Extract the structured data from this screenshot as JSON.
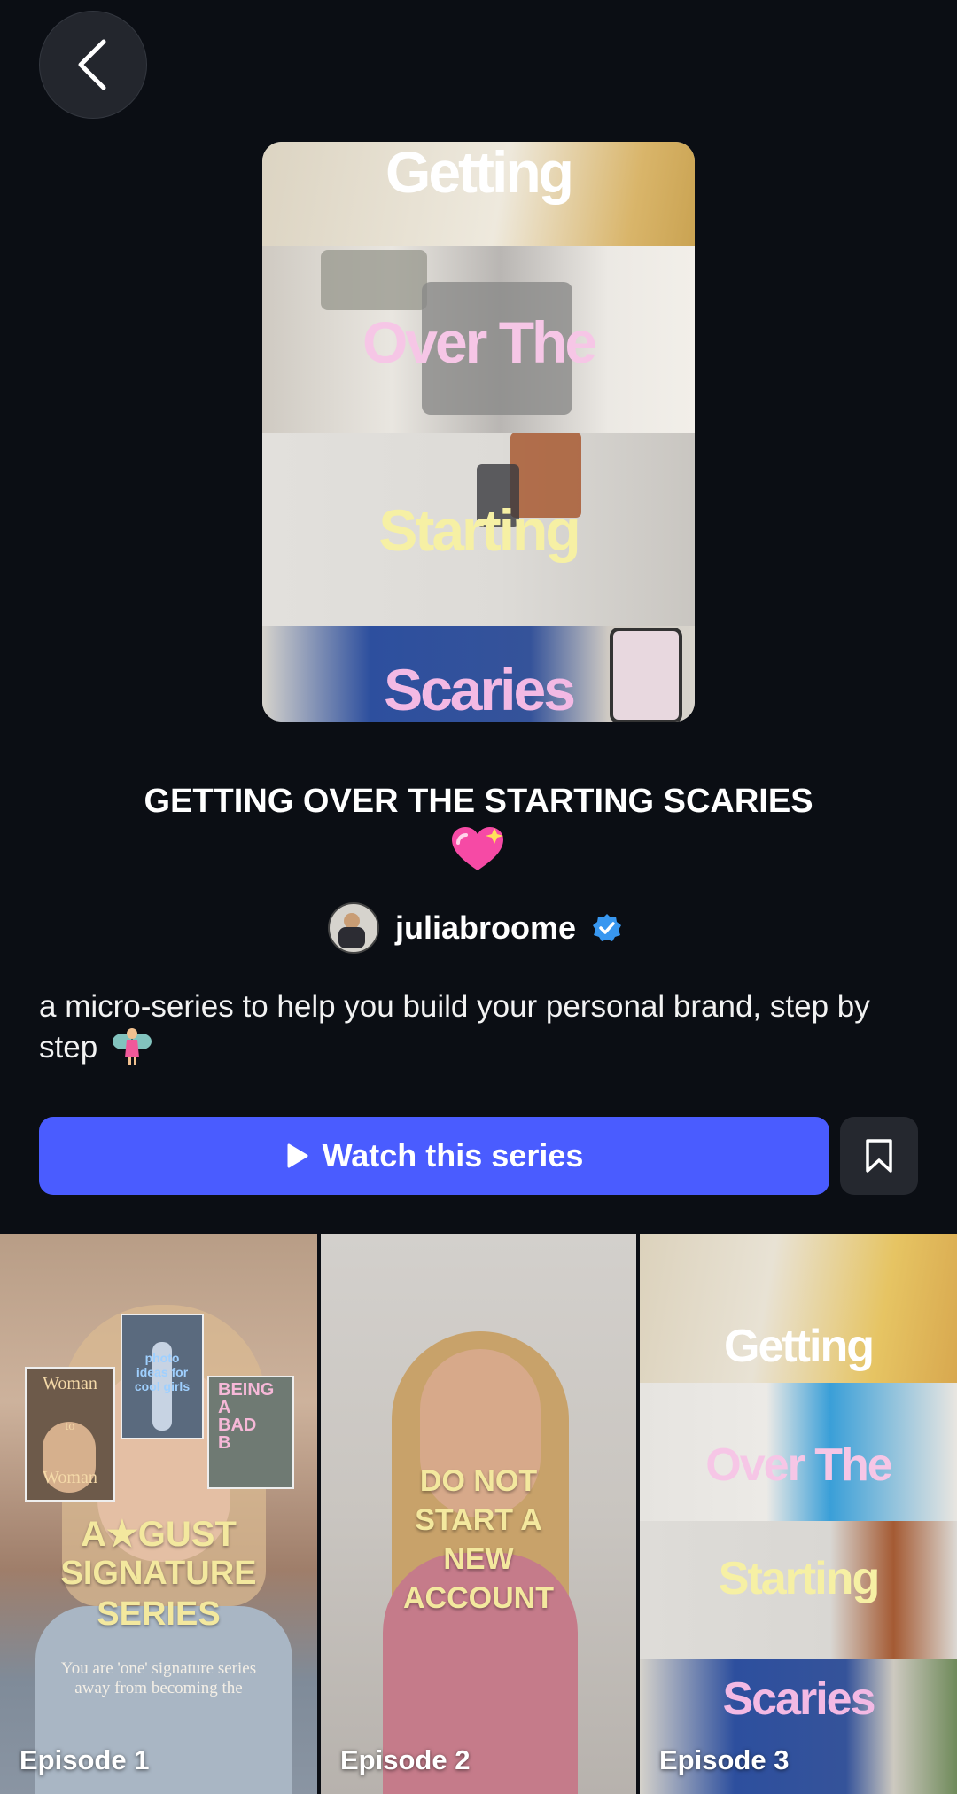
{
  "header": {
    "back_icon": "chevron-left-icon"
  },
  "cover": {
    "words": [
      "Getting",
      "Over The",
      "Starting",
      "Scaries"
    ],
    "colors": {
      "getting": "#ffffff",
      "over": "#f6c6e6",
      "starting": "#f6f0a4",
      "scaries": "#f3b9e4"
    }
  },
  "series": {
    "title": "GETTING OVER THE STARTING SCARIES",
    "title_emoji": "sparkling-heart-emoji",
    "creator": "juliabroome",
    "verified": true,
    "description": "a micro-series to help you build your personal brand, step by step",
    "description_emoji": "fairy-emoji"
  },
  "actions": {
    "watch_label": "Watch this series",
    "accent": "#4a5cff",
    "save_icon": "bookmark-icon"
  },
  "episodes": [
    {
      "label": "Episode 1",
      "collage_woman_top": "Woman",
      "collage_to": "to",
      "collage_woman_bottom": "Woman",
      "collage_photo": "photo ideas for cool girls",
      "collage_bad": "BEING A BAD B",
      "text_line1": "A★GUST",
      "text_line2": "SIGNATURE",
      "text_line3": "SERIES",
      "subtext": "You are 'one' signature series away from becoming the"
    },
    {
      "label": "Episode 2",
      "text_line1": "DO NOT",
      "text_line2": "START A",
      "text_line3": "NEW",
      "text_line4": "ACCOUNT"
    },
    {
      "label": "Episode 3",
      "words": [
        "Getting",
        "Over The",
        "Starting",
        "Scaries"
      ]
    }
  ]
}
